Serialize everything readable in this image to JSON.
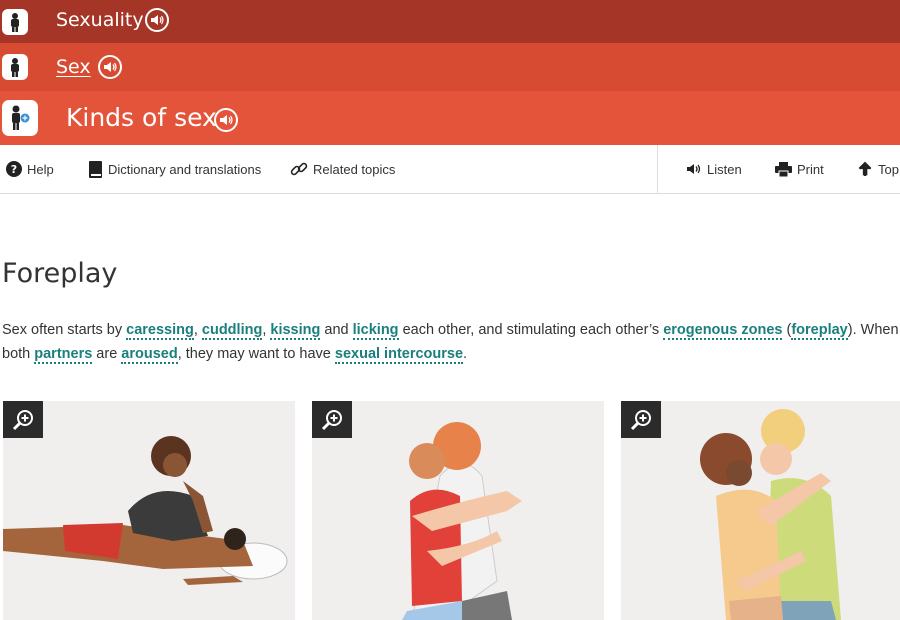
{
  "breadcrumb": {
    "level1": {
      "label": "Sexuality"
    },
    "level2": {
      "label": "Sex"
    },
    "level3": {
      "label": "Kinds of sex"
    }
  },
  "toolbar": {
    "help": "Help",
    "dictionary": "Dictionary and translations",
    "related": "Related topics",
    "listen": "Listen",
    "print": "Print",
    "top": "Top"
  },
  "section": {
    "title": "Foreplay",
    "paragraph": {
      "t1": "Sex often starts by ",
      "l1": "caressing",
      "t2": ", ",
      "l2": "cuddling",
      "t3": ", ",
      "l3": "kissing",
      "t4": " and ",
      "l4": "licking",
      "t5": " each other, and stimulating each other’s ",
      "l5": "erogenous zones",
      "t6": " (",
      "l6": "foreplay",
      "t7": "). When both ",
      "l7": "partners",
      "t8": " are ",
      "l8": "aroused",
      "t9": ", they may want to have ",
      "l9": "sexual intercourse",
      "t10": "."
    }
  },
  "images": [
    {
      "icon": "magnifier-plus-icon"
    },
    {
      "icon": "magnifier-plus-icon"
    },
    {
      "icon": "magnifier-plus-icon"
    }
  ],
  "colors": {
    "band1": "#a53527",
    "band2": "#d84b33",
    "band3": "#e3543a",
    "link": "#1a7f7d"
  }
}
